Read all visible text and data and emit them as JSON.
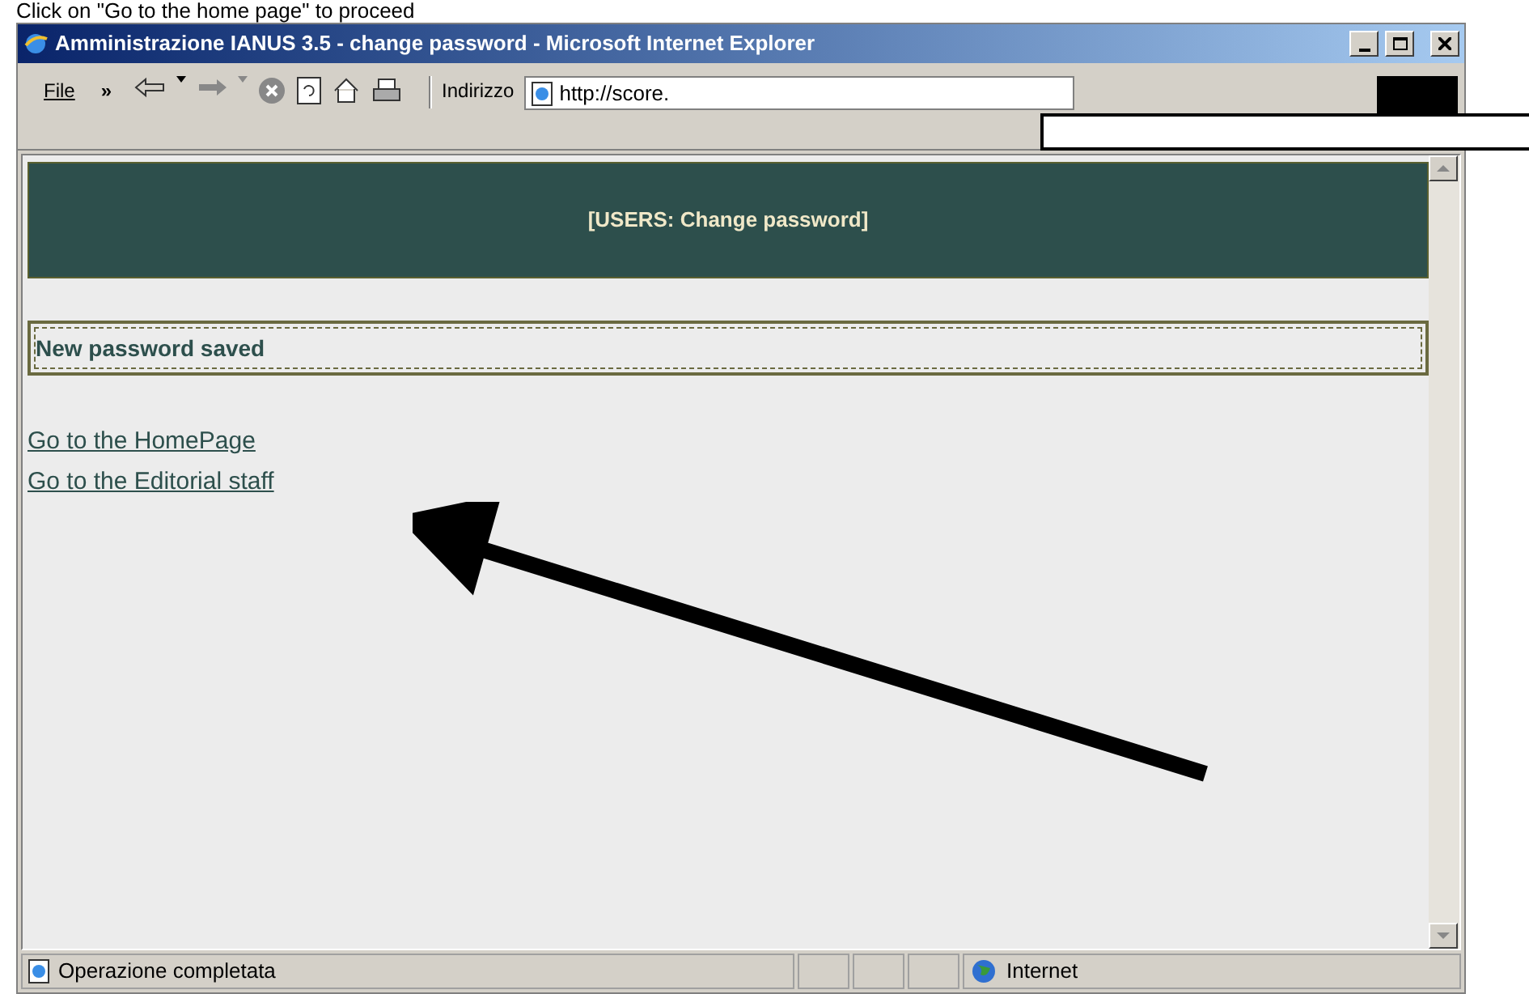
{
  "caption": "Click on \"Go to the home page\" to proceed",
  "window": {
    "title": "Amministrazione IANUS 3.5 - change password - Microsoft Internet Explorer"
  },
  "toolbar": {
    "menu": "File",
    "chevron": "»",
    "address_label": "Indirizzo",
    "address": "http://score."
  },
  "page": {
    "header": "[USERS: Change password]",
    "message": "New password saved",
    "links": [
      "Go to the HomePage",
      "Go to the Editorial staff"
    ]
  },
  "status_bar": {
    "text": "Operazione completata",
    "zone": "Internet"
  }
}
